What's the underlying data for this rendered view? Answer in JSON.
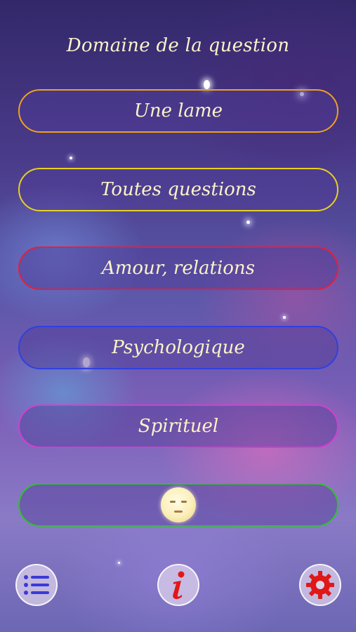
{
  "header": {
    "title": "Domaine de la question"
  },
  "choices": [
    {
      "label": "Une lame",
      "border_color": "#f0a020"
    },
    {
      "label": "Toutes questions",
      "border_color": "#e8d020"
    },
    {
      "label": "Amour, relations",
      "border_color": "#e02040"
    },
    {
      "label": "Psychologique",
      "border_color": "#3040e0"
    },
    {
      "label": "Spirituel",
      "border_color": "#d040d0"
    },
    {
      "label": "",
      "border_color": "#30c030",
      "icon": "moon-face-icon"
    }
  ],
  "bottom_bar": {
    "menu_icon": "list-icon",
    "info_icon": "info-icon",
    "settings_icon": "gear-icon",
    "menu_accent": "#3a3ad8",
    "info_accent": "#e01818",
    "settings_accent": "#e01818"
  }
}
